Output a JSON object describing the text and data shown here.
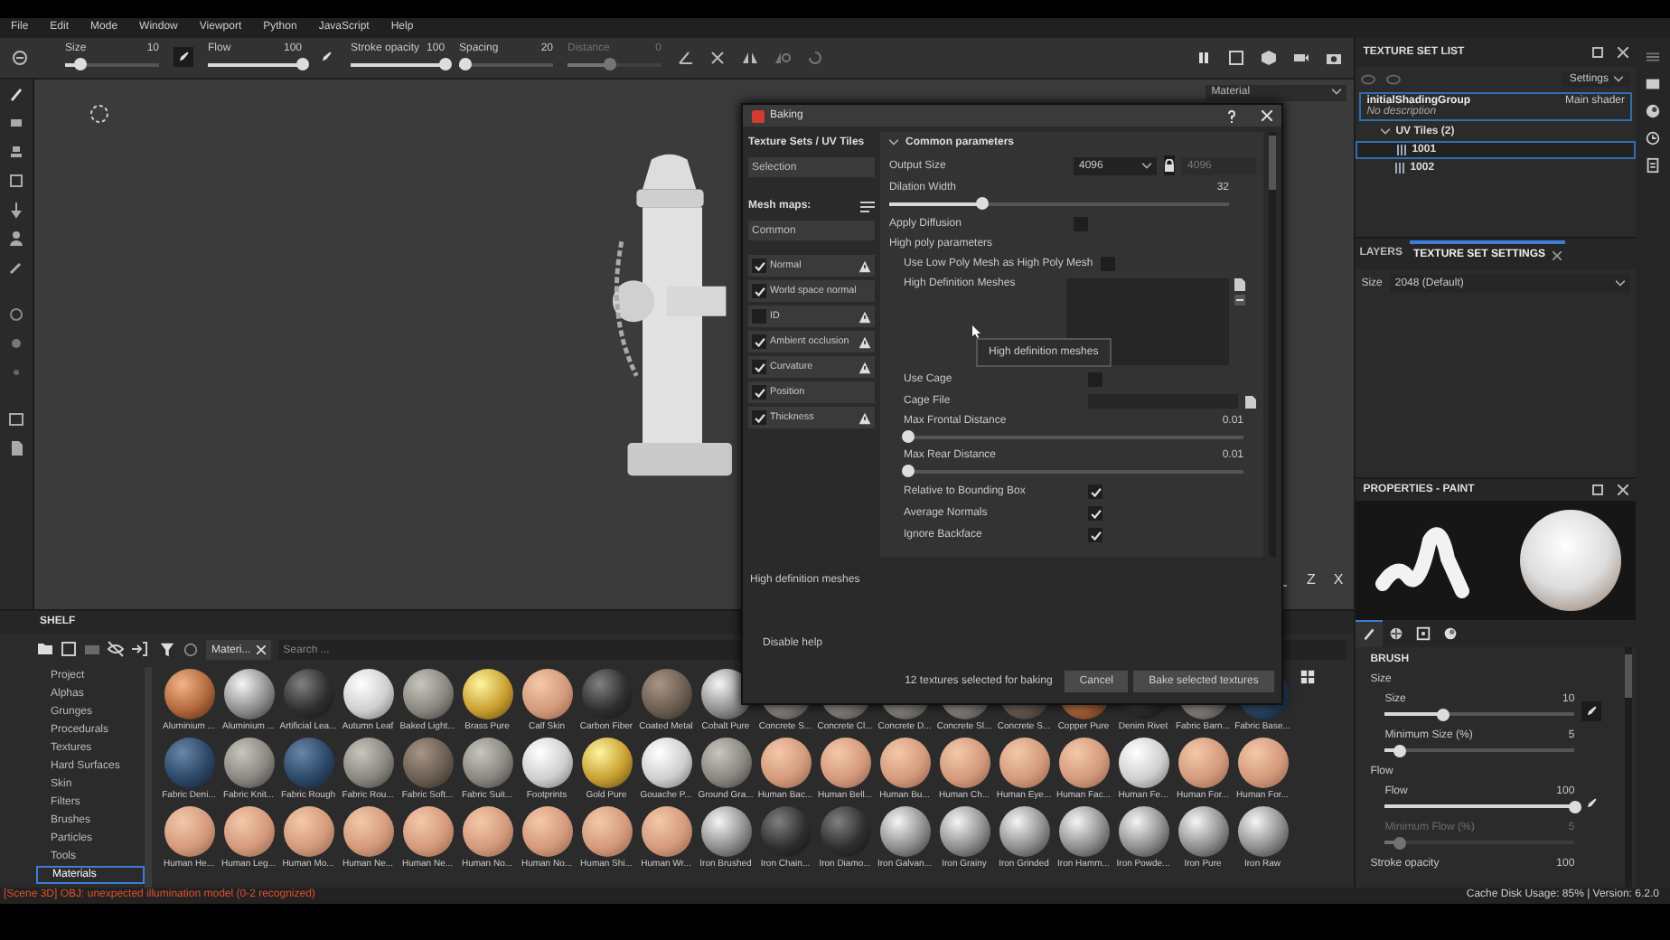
{
  "menu": [
    "File",
    "Edit",
    "Mode",
    "Window",
    "Viewport",
    "Python",
    "JavaScript",
    "Help"
  ],
  "toolbar": {
    "sliders": [
      {
        "label": "Size",
        "reading": "10",
        "level": 0.15,
        "pen": true,
        "disabled": false
      },
      {
        "label": "Flow",
        "reading": "100",
        "level": 1,
        "pen": true,
        "disabled": false
      },
      {
        "label": "Stroke opacity",
        "reading": "100",
        "level": 1,
        "pen": false,
        "disabled": false
      },
      {
        "label": "Spacing",
        "reading": "20",
        "level": 0.05,
        "pen": false,
        "disabled": false
      },
      {
        "label": "Distance",
        "reading": "0",
        "level": 0.45,
        "pen": false,
        "disabled": true
      }
    ]
  },
  "viewport": {
    "dropdown": "Material",
    "gizmo_labels": [
      "Z",
      "X"
    ]
  },
  "texture_set_list": {
    "title": "TEXTURE SET LIST",
    "settings": "Settings",
    "set": {
      "name": "initialShadingGroup",
      "shader": "Main shader",
      "description": "No description",
      "selected": true,
      "group": {
        "label": "UV Tiles (2)",
        "expanded": true,
        "children": [
          {
            "label": "1001",
            "selected": true
          },
          {
            "label": "1002",
            "selected": false
          }
        ]
      }
    }
  },
  "settings_tabs": [
    {
      "label": "LAYERS",
      "selected": false
    },
    {
      "label": "TEXTURE SET SETTINGS",
      "selected": true
    }
  ],
  "size_field": {
    "label": "Size",
    "value": "2048 (Default)"
  },
  "properties": {
    "title": "PROPERTIES - PAINT",
    "tabs": [
      {
        "kind": "brush",
        "selected": true
      },
      {
        "kind": "alpha",
        "selected": false
      },
      {
        "kind": "stencil",
        "selected": false
      },
      {
        "kind": "material",
        "selected": false
      }
    ],
    "section": "BRUSH",
    "groups": [
      {
        "label": "Size",
        "sliders": [
          {
            "label": "Size",
            "reading": "10",
            "level": 0.3,
            "pen": true,
            "disabled": false
          },
          {
            "label": "Minimum Size (%)",
            "reading": "5",
            "level": 0.07,
            "pen": false,
            "disabled": false
          }
        ]
      },
      {
        "label": "Flow",
        "sliders": [
          {
            "label": "Flow",
            "reading": "100",
            "level": 1,
            "pen": true,
            "disabled": false
          },
          {
            "label": "Minimum Flow (%)",
            "reading": "5",
            "level": 0.07,
            "pen": false,
            "disabled": true
          }
        ]
      }
    ],
    "cut_row": {
      "label": "Stroke opacity",
      "reading": "100"
    }
  },
  "baking": {
    "title": "Baking",
    "sets_heading": "Texture Sets / UV Tiles",
    "selection": "Selection",
    "mesh_heading": "Mesh maps:",
    "common": "Common",
    "maps": [
      {
        "label": "Normal",
        "checked": true,
        "warning": true
      },
      {
        "label": "World space normal",
        "checked": true,
        "warning": false
      },
      {
        "label": "ID",
        "checked": false,
        "warning": true
      },
      {
        "label": "Ambient occlusion",
        "checked": true,
        "warning": true
      },
      {
        "label": "Curvature",
        "checked": true,
        "warning": true
      },
      {
        "label": "Position",
        "checked": true,
        "warning": false
      },
      {
        "label": "Thickness",
        "checked": true,
        "warning": true
      }
    ],
    "section": "Common parameters",
    "expanded": true,
    "params": [
      {
        "kind": "select",
        "label": "Output Size",
        "value": "4096",
        "locked": true,
        "linked_value": "4096"
      },
      {
        "kind": "slider",
        "label": "Dilation Width",
        "reading": "32",
        "level": 0.27
      },
      {
        "kind": "check",
        "label": "Apply Diffusion",
        "checked": false
      },
      {
        "kind": "heading",
        "label": "High poly parameters",
        "children": [
          {
            "kind": "check",
            "label": "Use Low Poly Mesh as High Poly Mesh",
            "checked": false
          },
          {
            "kind": "list",
            "label": "High Definition Meshes"
          },
          {
            "kind": "check",
            "label": "Use Cage",
            "checked": false
          },
          {
            "kind": "file",
            "label": "Cage File"
          },
          {
            "kind": "slider",
            "label": "Max Frontal Distance",
            "reading": "0.01",
            "level": 0.01
          },
          {
            "kind": "slider",
            "label": "Max Rear Distance",
            "reading": "0.01",
            "level": 0.01
          },
          {
            "kind": "check",
            "label": "Relative to Bounding Box",
            "checked": true
          },
          {
            "kind": "check",
            "label": "Average Normals",
            "checked": true
          },
          {
            "kind": "check",
            "label": "Ignore Backface",
            "checked": true
          }
        ]
      }
    ],
    "tooltip": "High definition meshes",
    "help_text": "High definition meshes",
    "disable_help": "Disable help",
    "status": "12 textures selected for baking",
    "buttons": [
      "Cancel",
      "Bake selected textures"
    ]
  },
  "shelf": {
    "title": "SHELF",
    "categories": [
      {
        "label": "Project",
        "selected": false
      },
      {
        "label": "Alphas",
        "selected": false
      },
      {
        "label": "Grunges",
        "selected": false
      },
      {
        "label": "Procedurals",
        "selected": false
      },
      {
        "label": "Textures",
        "selected": false
      },
      {
        "label": "Hard Surfaces",
        "selected": false
      },
      {
        "label": "Skin",
        "selected": false
      },
      {
        "label": "Filters",
        "selected": false
      },
      {
        "label": "Brushes",
        "selected": false
      },
      {
        "label": "Particles",
        "selected": false
      },
      {
        "label": "Tools",
        "selected": false
      },
      {
        "label": "Materials",
        "selected": true
      }
    ],
    "filter_chip": "Materi...",
    "search": {
      "placeholder": "Search ..."
    },
    "materials": [
      {
        "label": "Aluminium ...",
        "kind": "copper"
      },
      {
        "label": "Aluminium ...",
        "kind": "metal"
      },
      {
        "label": "Artificial Lea...",
        "kind": "dark"
      },
      {
        "label": "Autumn Leaf",
        "kind": "white"
      },
      {
        "label": "Baked Light...",
        "kind": "grey"
      },
      {
        "label": "Brass Pure",
        "kind": "gold"
      },
      {
        "label": "Calf Skin",
        "kind": "skin"
      },
      {
        "label": "Carbon Fiber",
        "kind": "dark"
      },
      {
        "label": "Coated Metal",
        "kind": "fabric"
      },
      {
        "label": "Cobalt Pure",
        "kind": "metal"
      },
      {
        "label": "Concrete S...",
        "kind": "grey"
      },
      {
        "label": "Concrete Cl...",
        "kind": "grey"
      },
      {
        "label": "Concrete D...",
        "kind": "grey"
      },
      {
        "label": "Concrete Sl...",
        "kind": "grey"
      },
      {
        "label": "Concrete S...",
        "kind": "fabric"
      },
      {
        "label": "Copper Pure",
        "kind": "copper"
      },
      {
        "label": "Denim Rivet",
        "kind": "dark"
      },
      {
        "label": "Fabric Barn...",
        "kind": "grey"
      },
      {
        "label": "Fabric Base...",
        "kind": "blue"
      },
      {
        "label": "Fabric Deni...",
        "kind": "blue"
      },
      {
        "label": "Fabric Knit...",
        "kind": "grey"
      },
      {
        "label": "Fabric Rough",
        "kind": "blue"
      },
      {
        "label": "Fabric Rou...",
        "kind": "grey"
      },
      {
        "label": "Fabric Soft...",
        "kind": "fabric"
      },
      {
        "label": "Fabric Suit...",
        "kind": "grey"
      },
      {
        "label": "Footprints",
        "kind": "white"
      },
      {
        "label": "Gold Pure",
        "kind": "gold"
      },
      {
        "label": "Gouache P...",
        "kind": "white"
      },
      {
        "label": "Ground Gra...",
        "kind": "grey"
      },
      {
        "label": "Human Bac...",
        "kind": "skin"
      },
      {
        "label": "Human Bell...",
        "kind": "skin"
      },
      {
        "label": "Human Bu...",
        "kind": "skin"
      },
      {
        "label": "Human Ch...",
        "kind": "skin"
      },
      {
        "label": "Human Eye...",
        "kind": "skin"
      },
      {
        "label": "Human Fac...",
        "kind": "skin"
      },
      {
        "label": "Human Fe...",
        "kind": "white"
      },
      {
        "label": "Human For...",
        "kind": "skin"
      },
      {
        "label": "Human For...",
        "kind": "skin"
      },
      {
        "label": "Human He...",
        "kind": "skin"
      },
      {
        "label": "Human Leg...",
        "kind": "skin"
      },
      {
        "label": "Human Mo...",
        "kind": "skin"
      },
      {
        "label": "Human Ne...",
        "kind": "skin"
      },
      {
        "label": "Human Ne...",
        "kind": "skin"
      },
      {
        "label": "Human No...",
        "kind": "skin"
      },
      {
        "label": "Human No...",
        "kind": "skin"
      },
      {
        "label": "Human Shi...",
        "kind": "skin"
      },
      {
        "label": "Human Wr...",
        "kind": "skin"
      },
      {
        "label": "Iron Brushed",
        "kind": "metal"
      },
      {
        "label": "Iron Chain...",
        "kind": "dark"
      },
      {
        "label": "Iron Diamo...",
        "kind": "dark"
      },
      {
        "label": "Iron Galvan...",
        "kind": "metal"
      },
      {
        "label": "Iron Grainy",
        "kind": "metal"
      },
      {
        "label": "Iron Grinded",
        "kind": "metal"
      },
      {
        "label": "Iron Hamm...",
        "kind": "metal"
      },
      {
        "label": "Iron Powde...",
        "kind": "metal"
      },
      {
        "label": "Iron Pure",
        "kind": "metal"
      },
      {
        "label": "Iron Raw",
        "kind": "metal"
      }
    ]
  },
  "status_bar": {
    "message": "[Scene 3D] OBJ: unexpected illumination model (0-2 recognized)",
    "cache": "Cache Disk Usage:  85% | Version: 6.2.0"
  }
}
